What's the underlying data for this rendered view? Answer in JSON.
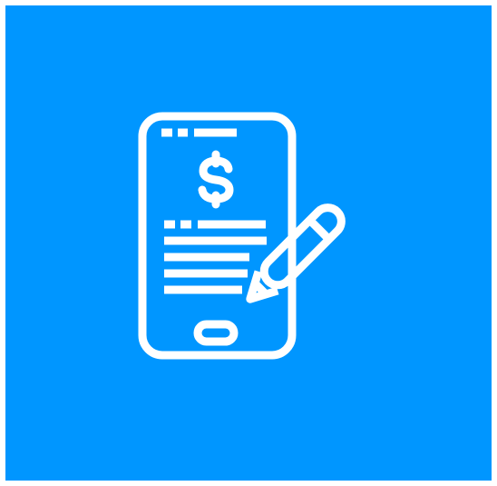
{
  "colors": {
    "background": "#0096FF",
    "icon_stroke": "#FFFFFF",
    "page": "#FFFFFF"
  },
  "icon": {
    "name": "mobile-payment-sign-icon",
    "parts": [
      "phone-icon",
      "dollar-sign-icon",
      "document-lines-icon",
      "pencil-icon"
    ]
  }
}
